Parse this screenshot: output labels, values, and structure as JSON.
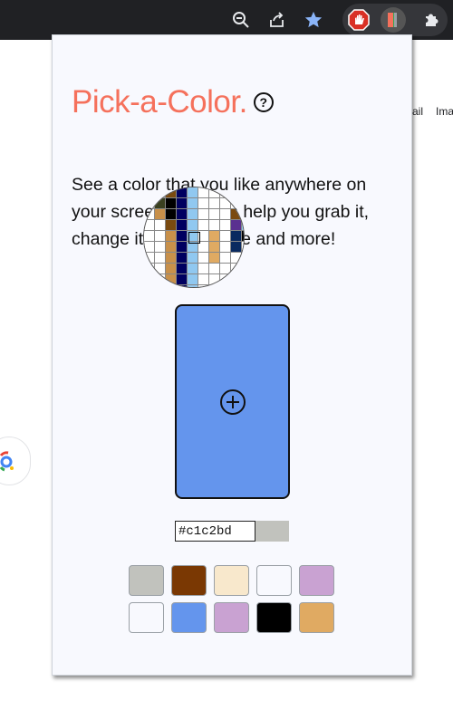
{
  "toolbar": {
    "icons": [
      "zoom-out-icon",
      "share-icon",
      "bookmark-star-icon",
      "adblock-icon",
      "color-picker-extension-icon",
      "extensions-puzzle-icon"
    ],
    "star_color": "#8ab4f8",
    "adblock_color": "#d93025"
  },
  "underlay": {
    "link_gmail": "ail",
    "link_images": "Ima"
  },
  "app": {
    "title": "Pick-a-Color.",
    "help_glyph": "?",
    "intro": "See a color that you like anywhere on your screen? We can help you grab it, change its opacity, hue and more!",
    "title_color": "#f5715c"
  },
  "picker": {
    "preview_color": "#6495ed",
    "hex_value": "#c1c2bd",
    "current_swatch": "#c1c2bd"
  },
  "palette": [
    "#c1c2bd",
    "#7a3803",
    "#f8e8cc",
    "#f8f9fe",
    "#c9a2d2",
    "#f8f9fe",
    "#6495ed",
    "#c9a2d2",
    "#000000",
    "#e0aa62"
  ],
  "loupe": {
    "rows": [
      [
        "#ffffff",
        "#ffffff",
        "#7a4a10",
        "#000060",
        "#90c8f0",
        "#ffffff",
        "#ffffff",
        "#ffffff",
        "#ffffff",
        "#ffffff",
        "#ffffff"
      ],
      [
        "#ffffff",
        "#3a4020",
        "#000000",
        "#000060",
        "#90c8f0",
        "#ffffff",
        "#ffffff",
        "#ffffff",
        "#ffffff",
        "#ffffff",
        "#ffffff"
      ],
      [
        "#ffffff",
        "#c8904a",
        "#000000",
        "#000060",
        "#90c8f0",
        "#ffffff",
        "#ffffff",
        "#ffffff",
        "#7a4a10",
        "#ffffff",
        "#ffffff"
      ],
      [
        "#ffffff",
        "#ffffff",
        "#7a4a10",
        "#000060",
        "#90c8f0",
        "#ffffff",
        "#ffffff",
        "#ffffff",
        "#5a3090",
        "#90c8f0",
        "#ffffff"
      ],
      [
        "#ffffff",
        "#ffffff",
        "#c8904a",
        "#000060",
        "#90c8f0",
        "#ffffff",
        "#e0aa62",
        "#ffffff",
        "#0a2a60",
        "#000000",
        "#000000"
      ],
      [
        "#ffffff",
        "#ffffff",
        "#c8904a",
        "#000060",
        "#90c8f0",
        "#ffffff",
        "#e0aa62",
        "#ffffff",
        "#0a2a60",
        "#ffffff",
        "#ffffff"
      ],
      [
        "#ffffff",
        "#ffffff",
        "#c8904a",
        "#000060",
        "#90c8f0",
        "#ffffff",
        "#e0aa62",
        "#ffffff",
        "#ffffff",
        "#ffffff",
        "#ffffff"
      ],
      [
        "#ffffff",
        "#ffffff",
        "#c8904a",
        "#000060",
        "#90c8f0",
        "#ffffff",
        "#ffffff",
        "#ffffff",
        "#ffffff",
        "#ffffff",
        "#ffffff"
      ],
      [
        "#ffffff",
        "#ffffff",
        "#c8904a",
        "#000060",
        "#90c8f0",
        "#ffffff",
        "#ffffff",
        "#ffffff",
        "#ffffff",
        "#ffffff",
        "#ffffff"
      ],
      [
        "#ffffff",
        "#ffffff",
        "#c8904a",
        "#000060",
        "#90c8f0",
        "#ffffff",
        "#ffffff",
        "#ffffff",
        "#ffffff",
        "#ffffff",
        "#ffffff"
      ],
      [
        "#ffffff",
        "#ffffff",
        "#c8904a",
        "#000060",
        "#90c8f0",
        "#ffffff",
        "#ffffff",
        "#ffffff",
        "#ffffff",
        "#ffffff",
        "#ffffff"
      ]
    ]
  }
}
